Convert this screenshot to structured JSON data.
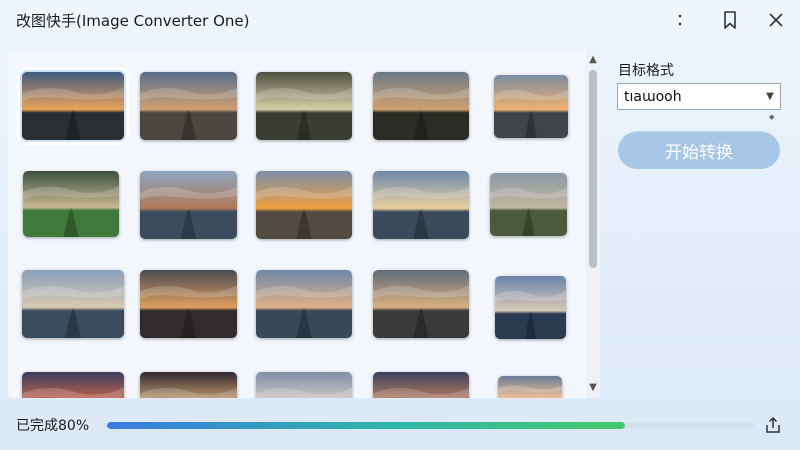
{
  "window": {
    "title": "改图快手(Image Converter One)",
    "controls": [
      "more-icon",
      "bookmark-icon",
      "close-icon"
    ]
  },
  "gallery": {
    "rows": [
      [
        {
          "scene": "sunset-road",
          "selected": true
        },
        {
          "scene": "boardwalk-dusk",
          "selected": false
        },
        {
          "scene": "stone-tiles",
          "selected": false
        },
        {
          "scene": "forest-path",
          "selected": false
        },
        {
          "scene": "city-street",
          "selected": false
        }
      ],
      [
        {
          "scene": "meadow-tent",
          "selected": false
        },
        {
          "scene": "mountain-lake",
          "selected": false
        },
        {
          "scene": "beach-tent",
          "selected": false
        },
        {
          "scene": "coast-figure",
          "selected": false
        },
        {
          "scene": "field-path",
          "selected": false
        }
      ],
      [
        {
          "scene": "lake-figure",
          "selected": false
        },
        {
          "scene": "alley-car",
          "selected": false
        },
        {
          "scene": "shore-figure",
          "selected": false
        },
        {
          "scene": "wet-road",
          "selected": false
        },
        {
          "scene": "calm-lake",
          "selected": false
        }
      ],
      [
        {
          "scene": "sunset-sky",
          "selected": false
        },
        {
          "scene": "starburst",
          "selected": false
        },
        {
          "scene": "cloud-sky",
          "selected": false
        },
        {
          "scene": "dusk-sky",
          "selected": false
        },
        {
          "scene": "skyline",
          "selected": false
        }
      ]
    ]
  },
  "sidebar": {
    "format_label": "目标格式",
    "format_value": "tıaɯooh",
    "convert_button": "开始转换"
  },
  "status": {
    "text": "已完成80%",
    "progress": 0.8
  },
  "colors": {
    "accent_button": "#a7c7e6",
    "progress_start": "#3a7be0",
    "progress_end": "#45c96a"
  }
}
